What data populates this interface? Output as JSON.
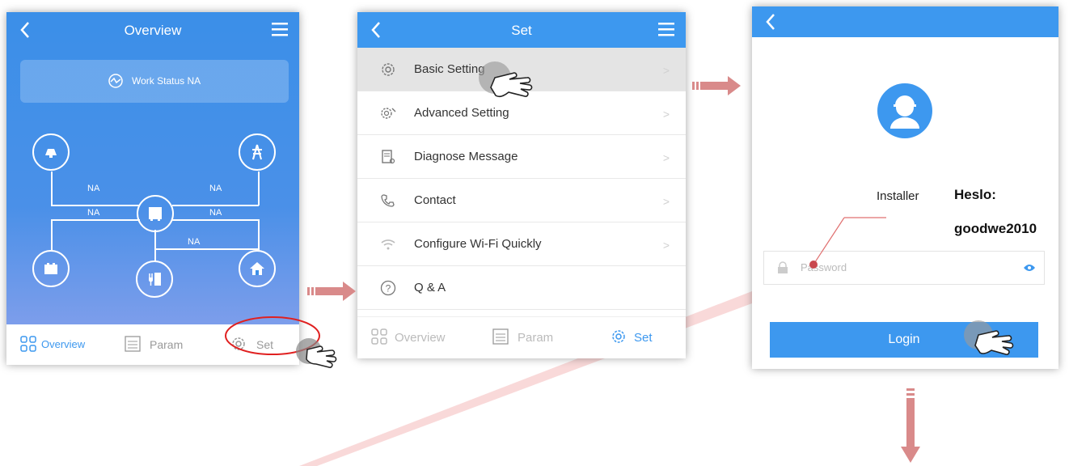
{
  "screen_overview": {
    "title": "Overview",
    "work_status": "Work Status NA",
    "na_labels": [
      "NA",
      "NA",
      "NA",
      "NA",
      "NA"
    ],
    "tabs": [
      {
        "label": "Overview",
        "icon": "grid-icon"
      },
      {
        "label": "Param",
        "icon": "param-icon"
      },
      {
        "label": "Set",
        "icon": "gear-icon"
      }
    ]
  },
  "screen_set": {
    "title": "Set",
    "items": [
      {
        "label": "Basic Setting",
        "icon": "gear-icon"
      },
      {
        "label": "Advanced Setting",
        "icon": "advanced-gear-icon"
      },
      {
        "label": "Diagnose Message",
        "icon": "document-search-icon"
      },
      {
        "label": "Contact",
        "icon": "phone-icon"
      },
      {
        "label": "Configure Wi-Fi Quickly",
        "icon": "wifi-icon"
      },
      {
        "label": "Q & A",
        "icon": "question-icon"
      }
    ],
    "tabs": [
      {
        "label": "Overview"
      },
      {
        "label": "Param"
      },
      {
        "label": "Set"
      }
    ]
  },
  "screen_login": {
    "role": "Installer",
    "password_placeholder": "Password",
    "login_label": "Login"
  },
  "annotation": {
    "line1": "Heslo:",
    "line2": "goodwe2010"
  },
  "colors": {
    "primary": "#3d98ef",
    "arrow": "#d98a8a",
    "highlight_circle": "#e02020"
  }
}
